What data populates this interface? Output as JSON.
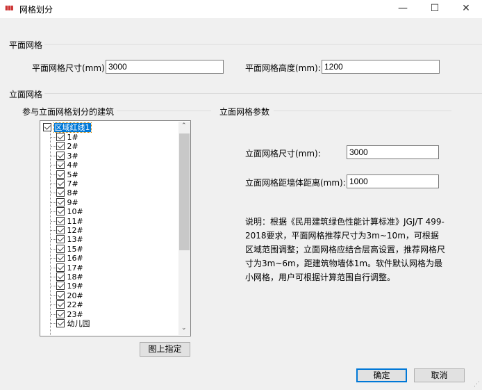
{
  "window": {
    "title": "网格划分",
    "minimize": "—",
    "maximize": "☐",
    "close": "✕"
  },
  "plane": {
    "section": "平面网格",
    "size_label": "平面网格尺寸(mm):",
    "size_value": "3000",
    "height_label": "平面网格高度(mm):",
    "height_value": "1200"
  },
  "elevation": {
    "section": "立面网格",
    "buildings_group": "参与立面网格划分的建筑",
    "params_group": "立面网格参数",
    "tree": {
      "root": "区域红线1",
      "items": [
        "1#",
        "2#",
        "3#",
        "4#",
        "5#",
        "7#",
        "8#",
        "9#",
        "10#",
        "11#",
        "12#",
        "13#",
        "15#",
        "16#",
        "17#",
        "18#",
        "19#",
        "20#",
        "22#",
        "23#",
        "幼儿园"
      ]
    },
    "pick_button": "图上指定",
    "size_label": "立面网格尺寸(mm):",
    "size_value": "3000",
    "distance_label": "立面网格距墙体距离(mm):",
    "distance_value": "1000",
    "note": "说明：根据《民用建筑绿色性能计算标准》JGJ/T 499-2018要求，平面网格推荐尺寸为3m~10m，可根据区域范围调整；立面网格应结合层高设置，推荐网格尺寸为3m~6m，距建筑物墙体1m。软件默认网格为最小网格，用户可根据计算范围自行调整。"
  },
  "buttons": {
    "ok": "确定",
    "cancel": "取消"
  },
  "colors": {
    "selection": "#0078d7",
    "default_button_border": "#0078d7"
  }
}
